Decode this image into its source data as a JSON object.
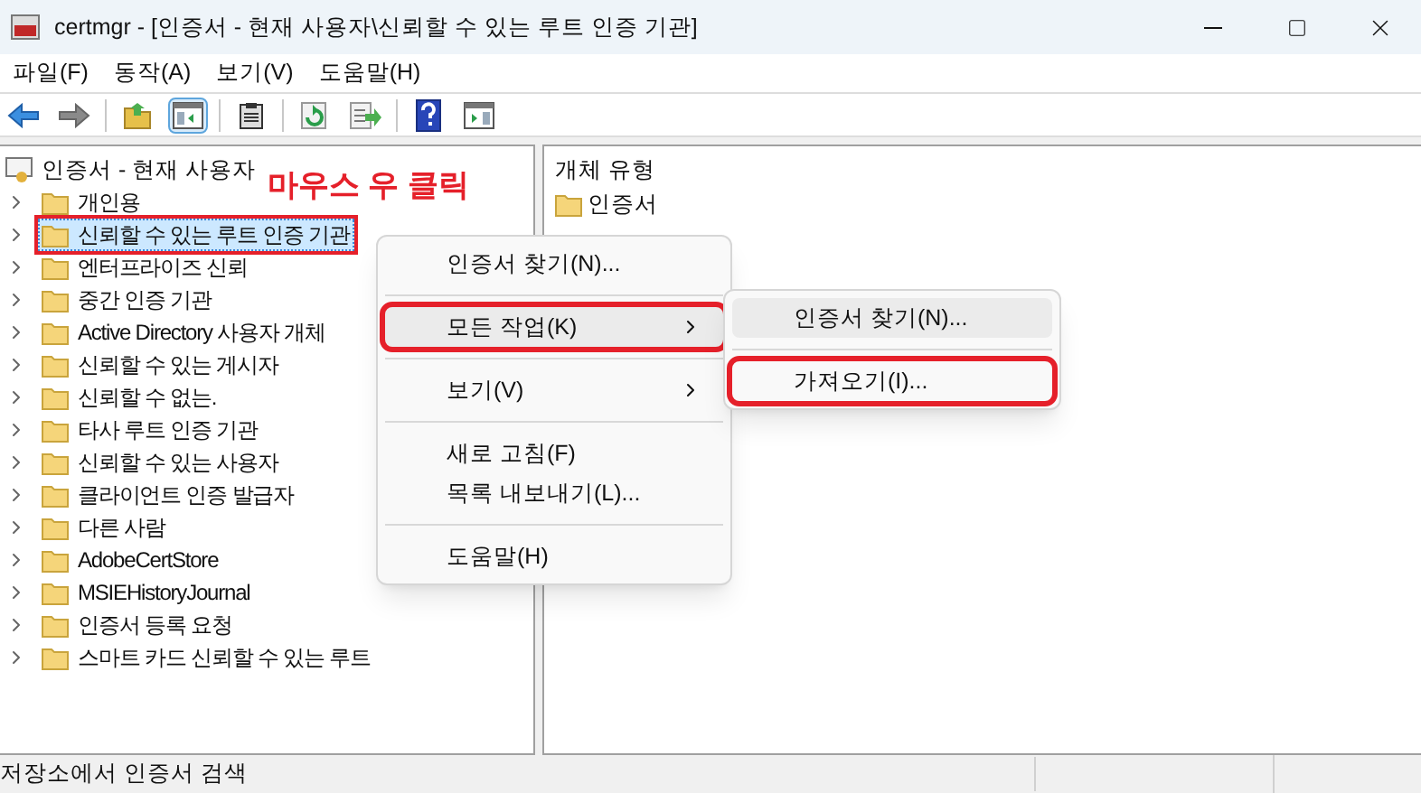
{
  "window": {
    "title": "certmgr - [인증서 - 현재 사용자\\신뢰할 수 있는 루트 인증 기관]"
  },
  "menu_bar": [
    "파일(F)",
    "동작(A)",
    "보기(V)",
    "도움말(H)"
  ],
  "toolbar": [
    {
      "kind": "back",
      "pressed": false
    },
    {
      "kind": "forward",
      "pressed": false
    },
    {
      "kind": "separator"
    },
    {
      "kind": "up",
      "pressed": false
    },
    {
      "kind": "pane",
      "pressed": true
    },
    {
      "kind": "separator"
    },
    {
      "kind": "clipboard",
      "pressed": false
    },
    {
      "kind": "separator"
    },
    {
      "kind": "refresh",
      "pressed": false
    },
    {
      "kind": "export",
      "pressed": false
    },
    {
      "kind": "separator"
    },
    {
      "kind": "help",
      "pressed": false
    },
    {
      "kind": "panel",
      "pressed": false
    }
  ],
  "tree": {
    "root": "인증서 - 현재 사용자",
    "children": [
      {
        "label": "개인용",
        "selected": false,
        "expanded": false,
        "highlighted": false
      },
      {
        "label": "신뢰할 수 있는 루트 인증 기관",
        "selected": true,
        "expanded": false,
        "highlighted": true
      },
      {
        "label": "엔터프라이즈 신뢰",
        "selected": false,
        "expanded": false,
        "highlighted": false
      },
      {
        "label": "중간 인증 기관",
        "selected": false,
        "expanded": false,
        "highlighted": false
      },
      {
        "label": "Active Directory 사용자 개체",
        "selected": false,
        "expanded": false,
        "highlighted": false
      },
      {
        "label": "신뢰할 수 있는 게시자",
        "selected": false,
        "expanded": false,
        "highlighted": false
      },
      {
        "label": "신뢰할 수 없는.",
        "selected": false,
        "expanded": false,
        "highlighted": false
      },
      {
        "label": "타사 루트 인증 기관",
        "selected": false,
        "expanded": false,
        "highlighted": false
      },
      {
        "label": "신뢰할 수 있는 사용자",
        "selected": false,
        "expanded": false,
        "highlighted": false
      },
      {
        "label": "클라이언트 인증 발급자",
        "selected": false,
        "expanded": false,
        "highlighted": false
      },
      {
        "label": "다른 사람",
        "selected": false,
        "expanded": false,
        "highlighted": false
      },
      {
        "label": "AdobeCertStore",
        "selected": false,
        "expanded": false,
        "highlighted": false
      },
      {
        "label": "MSIEHistoryJournal",
        "selected": false,
        "expanded": false,
        "highlighted": false
      },
      {
        "label": "인증서 등록 요청",
        "selected": false,
        "expanded": false,
        "highlighted": false
      },
      {
        "label": "스마트 카드 신뢰할 수 있는 루트",
        "selected": false,
        "expanded": false,
        "highlighted": false
      }
    ]
  },
  "annotation": {
    "text": "마우스 우 클릭"
  },
  "right_pane": {
    "column": "개체 유형",
    "items": [
      "인증서"
    ]
  },
  "context_menu": [
    {
      "kind": "item",
      "label": "인증서 찾기(N)...",
      "hovered": false,
      "highlighted": false
    },
    {
      "kind": "separator"
    },
    {
      "kind": "submenu",
      "label": "모든 작업(K)",
      "hovered": true,
      "highlighted": true
    },
    {
      "kind": "separator"
    },
    {
      "kind": "submenu",
      "label": "보기(V)",
      "hovered": false,
      "highlighted": false
    },
    {
      "kind": "separator"
    },
    {
      "kind": "item",
      "label": "새로 고침(F)",
      "hovered": false,
      "highlighted": false
    },
    {
      "kind": "item",
      "label": "목록 내보내기(L)...",
      "hovered": false,
      "highlighted": false
    },
    {
      "kind": "separator"
    },
    {
      "kind": "item",
      "label": "도움말(H)",
      "hovered": false,
      "highlighted": false
    }
  ],
  "submenu": [
    {
      "kind": "item",
      "label": "인증서 찾기(N)...",
      "hovered": true,
      "highlighted": false
    },
    {
      "kind": "separator"
    },
    {
      "kind": "item",
      "label": "가져오기(I)...",
      "hovered": false,
      "highlighted": true
    }
  ],
  "status_bar": [
    "저장소에서 인증서 검색"
  ]
}
